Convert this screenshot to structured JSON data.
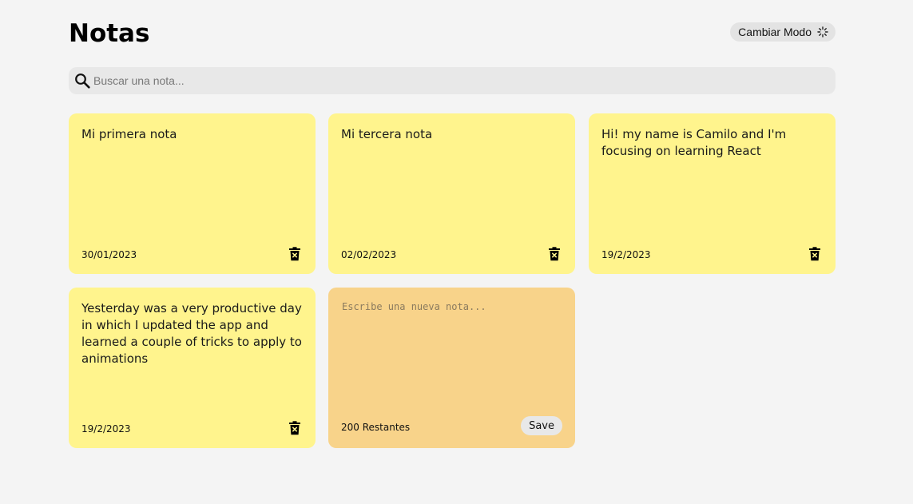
{
  "header": {
    "title": "Notas",
    "mode_button_label": "Cambiar Modo",
    "mode_icon": "spinner-icon"
  },
  "search": {
    "icon": "search-icon",
    "placeholder": "Buscar una nota...",
    "value": ""
  },
  "notes": [
    {
      "text": "Mi primera nota",
      "date": "30/01/2023"
    },
    {
      "text": "Mi tercera nota",
      "date": "02/02/2023"
    },
    {
      "text": "Hi! my name is Camilo and I'm focusing on learning React",
      "date": "19/2/2023"
    },
    {
      "text": "Yesterday was a very productive day in which I updated the app and learned a couple of tricks to apply to animations",
      "date": "19/2/2023"
    }
  ],
  "new_note": {
    "placeholder": "Escribe una nueva nota...",
    "value": "",
    "remaining": "200 Restantes",
    "save_label": "Save"
  },
  "colors": {
    "background": "#f4f4f4",
    "note": "#fff48d",
    "new_note": "#f8d38a",
    "search": "#e8e8e8"
  }
}
